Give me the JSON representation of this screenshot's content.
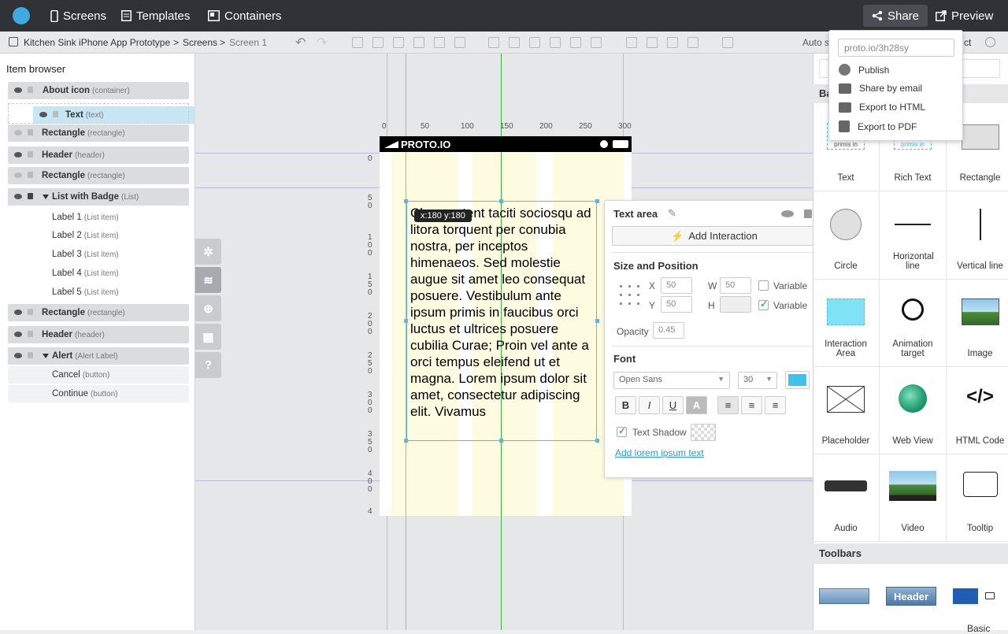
{
  "topbar": {
    "screens": "Screens",
    "templates": "Templates",
    "containers": "Containers",
    "share": "Share",
    "preview": "Preview"
  },
  "breadcrumb": {
    "project": "Kitchen Sink iPhone App Prototype",
    "sep1": ">",
    "screens": "Screens",
    "sep2": ">",
    "screen": "Screen 1",
    "auto_label": "Auto s",
    "ct": "ct"
  },
  "item_browser": {
    "title": "Item browser",
    "items": [
      {
        "name": "About icon",
        "type": "(container)"
      },
      {
        "name": "Text",
        "type": "(text)"
      },
      {
        "name": "Rectangle",
        "type": "(rectangle)"
      },
      {
        "name": "Header",
        "type": "(header)"
      },
      {
        "name": "Rectangle",
        "type": "(rectangle)"
      },
      {
        "name": "List with Badge",
        "type": "(List)"
      },
      {
        "name": "Label 1",
        "type": "(List item)"
      },
      {
        "name": "Label 2",
        "type": "(List item)"
      },
      {
        "name": "Label 3",
        "type": "(List item)"
      },
      {
        "name": "Label 4",
        "type": "(List item)"
      },
      {
        "name": "Label 5",
        "type": "(List item)"
      },
      {
        "name": "Rectangle",
        "type": "(rectangle)"
      },
      {
        "name": "Header",
        "type": "(header)"
      },
      {
        "name": "Alert",
        "type": "(Alert Label)"
      },
      {
        "name": "Cancel",
        "type": "(button)"
      },
      {
        "name": "Continue",
        "type": "(button)"
      }
    ]
  },
  "side_tools": {
    "help": "?"
  },
  "canvas": {
    "carrier": "PROTO.IO",
    "top_ruler": [
      "0",
      "50",
      "100",
      "150",
      "200",
      "250",
      "300"
    ],
    "left_ruler": [
      "0",
      "5\n0",
      "1\n0\n0",
      "1\n5\n0",
      "2\n0\n0",
      "2\n5\n0",
      "3\n0\n0",
      "3\n5\n0",
      "4\n0\n0",
      "4"
    ],
    "coord_tip": "x:180 y:180",
    "text_content": "Class aptent taciti sociosqu ad litora torquent per conubia nostra, per inceptos himenaeos. Sed molestie augue sit amet leo consequat posuere. Vestibulum ante ipsum primis in faucibus orci luctus et ultrices posuere cubilia Curae; Proin vel ante a orci tempus eleifend ut et magna. Lorem ipsum dolor sit amet, consectetur adipiscing elit. Vivamus"
  },
  "properties": {
    "title": "Text area",
    "add_interaction": "Add Interaction",
    "size_position": "Size and Position",
    "x_label": "X",
    "x_value": "50",
    "y_label": "Y",
    "y_value": "50",
    "w_label": "W",
    "w_value": "50",
    "h_label": "H",
    "h_value": "",
    "variable1": "Variable",
    "variable2": "Variable",
    "opacity_label": "Opacity",
    "opacity_value": "0.45",
    "font_header": "Font",
    "font_family": "Open Sans",
    "font_size": "30",
    "font_color": "#3fc1f0",
    "bold": "B",
    "italic": "I",
    "underline": "U",
    "text_color_btn": "A",
    "text_shadow": "Text Shadow",
    "lorem_link": "Add lorem ipsum text"
  },
  "right_panel": {
    "basic_header": "Ba",
    "components": [
      {
        "label": "Text",
        "icon": "text-icon"
      },
      {
        "label": "Rich Text",
        "icon": "rich-text-icon"
      },
      {
        "label": "Rectangle",
        "icon": "rectangle-icon"
      },
      {
        "label": "Circle",
        "icon": "circle-icon"
      },
      {
        "label": "Horizontal line",
        "icon": "horizontal-line-icon"
      },
      {
        "label": "Vertical line",
        "icon": "vertical-line-icon"
      },
      {
        "label": "Interaction Area",
        "icon": "interaction-area-icon"
      },
      {
        "label": "Animation target",
        "icon": "animation-target-icon"
      },
      {
        "label": "Image",
        "icon": "image-icon"
      },
      {
        "label": "Placeholder",
        "icon": "placeholder-icon"
      },
      {
        "label": "Web View",
        "icon": "web-view-icon"
      },
      {
        "label": "HTML Code",
        "icon": "html-code-icon"
      },
      {
        "label": "Audio",
        "icon": "audio-icon"
      },
      {
        "label": "Video",
        "icon": "video-icon"
      },
      {
        "label": "Tooltip",
        "icon": "tooltip-icon"
      }
    ],
    "text_preview": "primis in",
    "html_code_glyph": "</>",
    "toolbars_header": "Toolbars",
    "toolbar_header_btn": "Header",
    "toolbar_basic": "Basic"
  },
  "share_menu": {
    "url": "proto.io/3h28sy",
    "items": [
      "Publish",
      "Share by email",
      "Export to HTML",
      "Export to PDF"
    ]
  }
}
